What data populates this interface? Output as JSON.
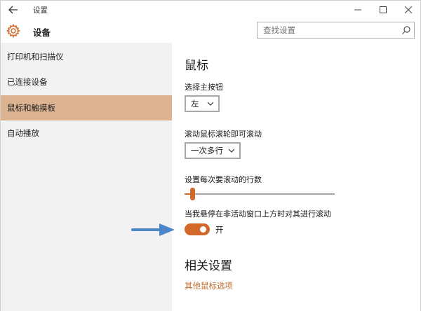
{
  "window": {
    "title": "设置",
    "controls": {
      "minimize": "—",
      "maximize": "☐",
      "close": "✕"
    }
  },
  "header": {
    "title": "设备",
    "search_placeholder": "查找设置"
  },
  "sidebar": {
    "items": [
      {
        "label": "打印机和扫描仪",
        "active": false
      },
      {
        "label": "已连接设备",
        "active": false
      },
      {
        "label": "鼠标和触摸板",
        "active": true
      },
      {
        "label": "自动播放",
        "active": false
      }
    ]
  },
  "main": {
    "title": "鼠标",
    "primary_button": {
      "label": "选择主按钮",
      "value": "左"
    },
    "wheel_scroll": {
      "label": "滚动鼠标滚轮即可滚动",
      "value": "一次多行"
    },
    "lines_to_scroll": {
      "label": "设置每次要滚动的行数",
      "level": 0.05
    },
    "inactive_scroll": {
      "label": "当我悬停在非活动窗口上方时对其进行滚动",
      "state": "开",
      "on": true
    },
    "related_title": "相关设置",
    "related_link": "其他鼠标选项"
  },
  "colors": {
    "accent": "#d2692b",
    "active_nav": "#ddb491",
    "sidebar_bg": "#f2f2f2",
    "link": "#c06b2e",
    "arrow": "#4a86c8"
  },
  "icons": [
    "back-arrow-icon",
    "gear-icon",
    "search-icon",
    "chevron-down-icon"
  ]
}
